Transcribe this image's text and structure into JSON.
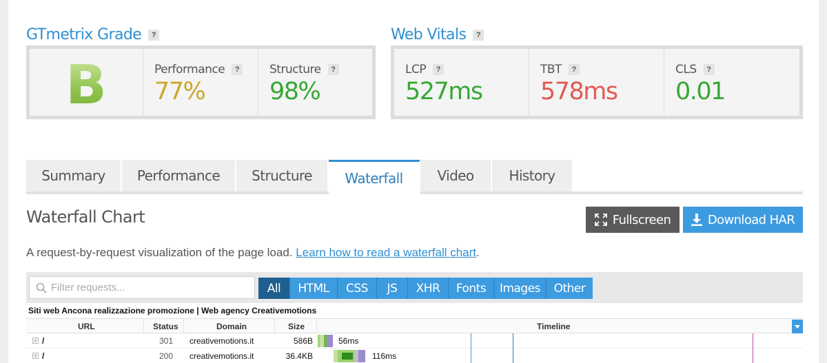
{
  "grade_panel": {
    "title": "GTmetrix Grade",
    "grade": "B",
    "metrics": [
      {
        "label": "Performance",
        "value": "77%",
        "color": "#c9a82c"
      },
      {
        "label": "Structure",
        "value": "98%",
        "color": "#36a835"
      }
    ]
  },
  "vitals_panel": {
    "title": "Web Vitals",
    "metrics": [
      {
        "label": "LCP",
        "value": "527ms",
        "color": "#36a835"
      },
      {
        "label": "TBT",
        "value": "578ms",
        "color": "#e25a55"
      },
      {
        "label": "CLS",
        "value": "0.01",
        "color": "#36a835"
      }
    ]
  },
  "help_label": "?",
  "tabs": [
    "Summary",
    "Performance",
    "Structure",
    "Waterfall",
    "Video",
    "History"
  ],
  "active_tab": "Waterfall",
  "waterfall": {
    "title": "Waterfall Chart",
    "fullscreen_label": "Fullscreen",
    "download_label": "Download HAR",
    "description": "A request-by-request visualization of the page load.",
    "learn_link": "Learn how to read a waterfall chart",
    "description_end": ".",
    "filter_placeholder": "Filter requests...",
    "filters": [
      "All",
      "HTML",
      "CSS",
      "JS",
      "XHR",
      "Fonts",
      "Images",
      "Other"
    ],
    "active_filter": "All",
    "page_title": "Siti web Ancona realizzazione promozione | Web agency Creativemotions",
    "columns": {
      "url": "URL",
      "status": "Status",
      "domain": "Domain",
      "size": "Size",
      "timeline": "Timeline"
    },
    "rows": [
      {
        "url": "/",
        "status": "301",
        "domain": "creativemotions.it",
        "size": "586B",
        "time": "56ms"
      },
      {
        "url": "/",
        "status": "200",
        "domain": "creativemotions.it",
        "size": "36.4KB",
        "time": "116ms"
      }
    ]
  },
  "colors": {
    "accent": "#2f8fd0",
    "button_blue": "#3d9be0",
    "button_dark": "#5a5a5a",
    "grade_green": "#8cc14b"
  }
}
